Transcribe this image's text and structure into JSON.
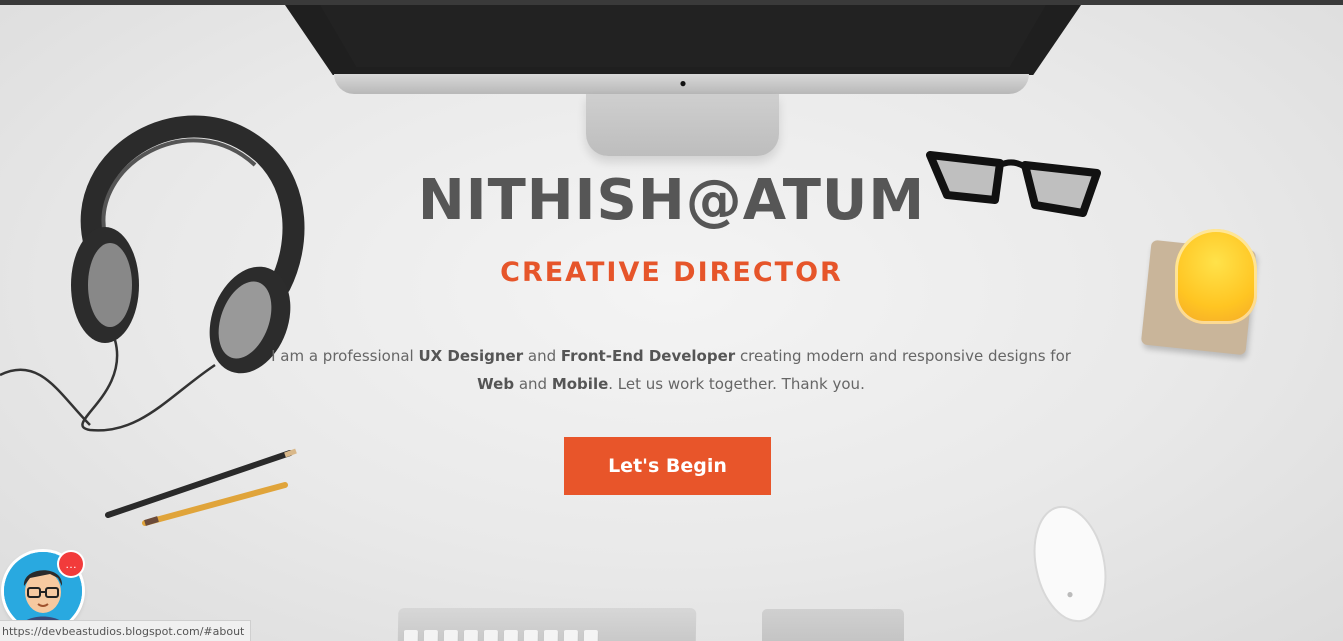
{
  "hero": {
    "title": "NITHISH@ATUM",
    "subtitle": "CREATIVE DIRECTOR",
    "description": {
      "p1": "I am a professional ",
      "b1": "UX Designer",
      "p2": " and ",
      "b2": "Front-End Developer",
      "p3": " creating modern and responsive designs for ",
      "b3": "Web",
      "p4": " and ",
      "b4": "Mobile",
      "p5": ". Let us work together. Thank you."
    },
    "cta_label": "Let's Begin"
  },
  "chat": {
    "badge_icon": "chat-bubble-icon"
  },
  "status_bar": {
    "url": "https://devbeastudios.blogspot.com/#about"
  },
  "colors": {
    "accent": "#e8552a",
    "title": "#565656",
    "text": "#666666",
    "chat_bg": "#29a9e0",
    "badge": "#f23b3b"
  }
}
